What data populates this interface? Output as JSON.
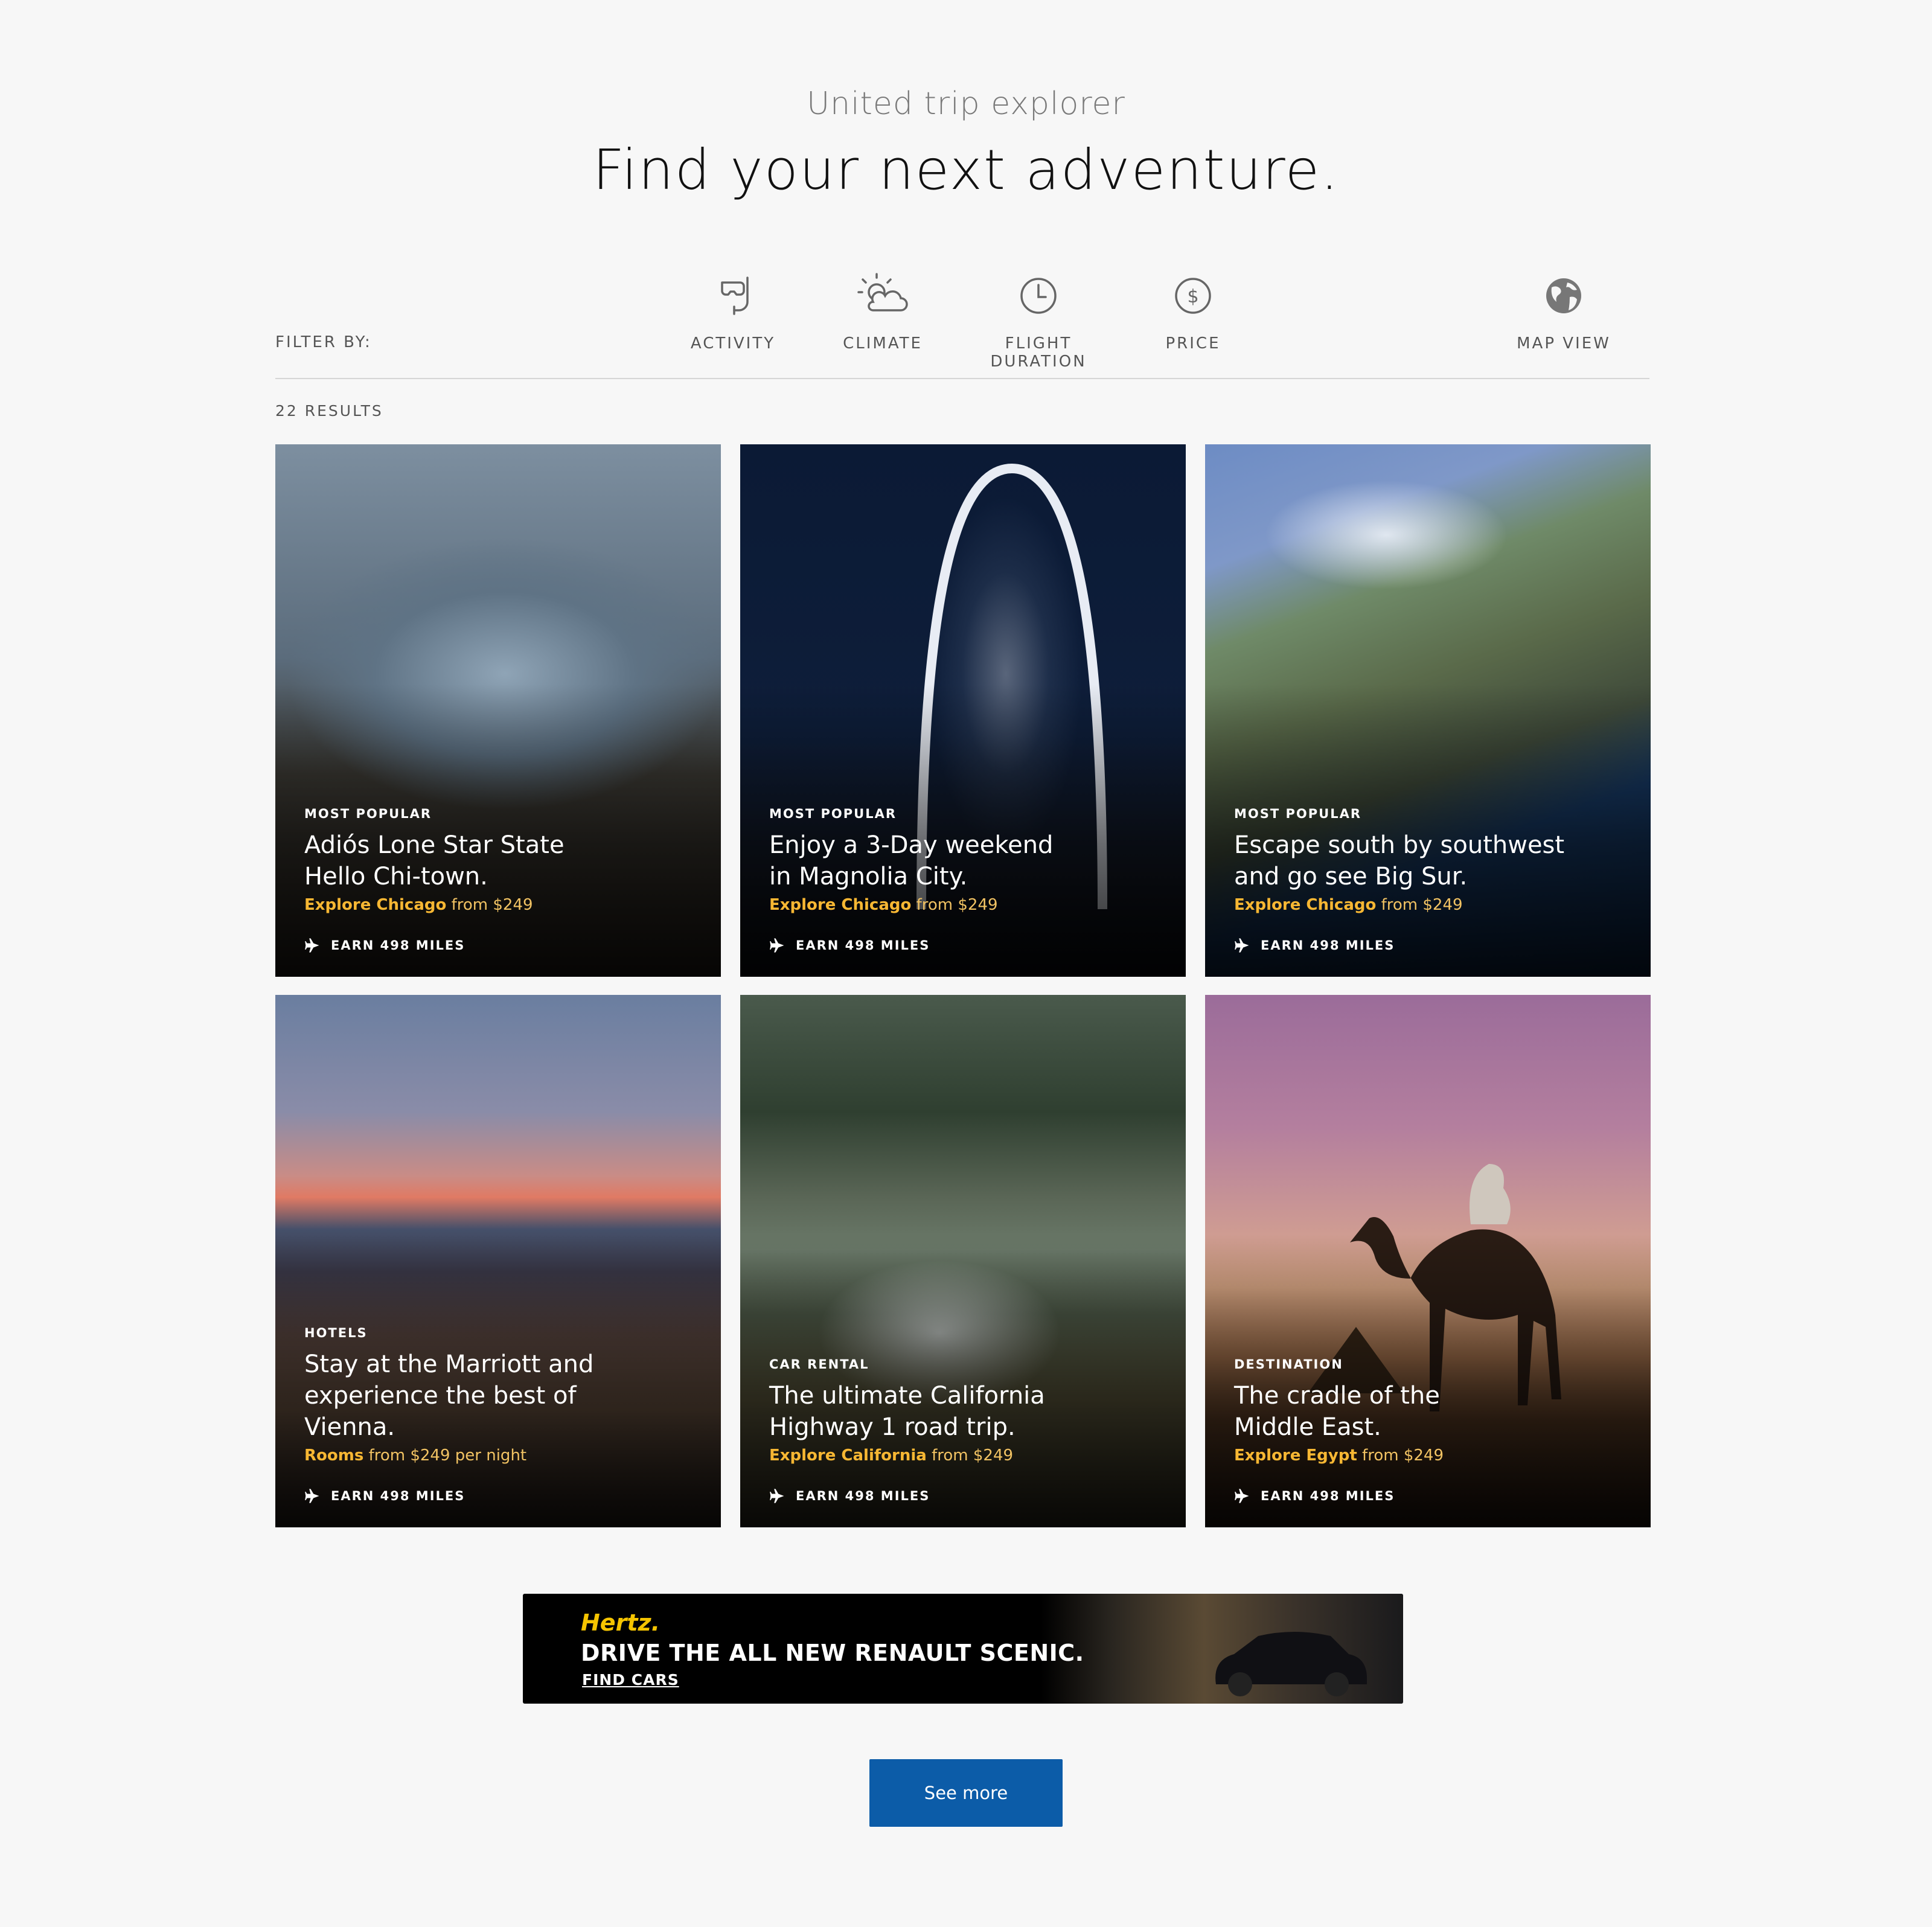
{
  "header": {
    "kicker": "United trip explorer",
    "title": "Find your next adventure."
  },
  "filters": {
    "label": "FILTER BY:",
    "items": [
      {
        "label": "ACTIVITY",
        "icon": "snorkel-icon"
      },
      {
        "label": "CLIMATE",
        "icon": "sun-cloud-icon"
      },
      {
        "label": "FLIGHT DURATION",
        "icon": "clock-icon"
      },
      {
        "label": "PRICE",
        "icon": "dollar-coin-icon"
      }
    ],
    "map_view": {
      "label": "MAP VIEW",
      "icon": "globe-icon"
    }
  },
  "results": {
    "count_text": "22 RESULTS"
  },
  "cards": [
    {
      "tag": "MOST POPULAR",
      "title": "Adiós Lone Star State\nHello Chi-town.",
      "highlight": "Explore Chicago",
      "rest": " from $249",
      "miles": "EARN 498 MILES"
    },
    {
      "tag": "MOST POPULAR",
      "title": "Enjoy a 3-Day weekend\nin Magnolia City.",
      "highlight": "Explore Chicago",
      "rest": " from $249",
      "miles": "EARN 498 MILES"
    },
    {
      "tag": "MOST POPULAR",
      "title": "Escape south by southwest\nand go see Big Sur.",
      "highlight": "Explore Chicago",
      "rest": " from $249",
      "miles": "EARN 498 MILES"
    },
    {
      "tag": "HOTELS",
      "title": "Stay at the Marriott and\nexperience the best of Vienna.",
      "highlight": "Rooms",
      "rest": " from $249 per night",
      "miles": "EARN 498 MILES"
    },
    {
      "tag": "CAR RENTAL",
      "title": "The ultimate California\nHighway 1 road trip.",
      "highlight": "Explore California",
      "rest": " from $249",
      "miles": "EARN 498 MILES"
    },
    {
      "tag": "DESTINATION",
      "title": "The cradle of the\nMiddle East.",
      "highlight": "Explore Egypt",
      "rest": " from $249",
      "miles": "EARN 498 MILES"
    }
  ],
  "ad": {
    "brand": "Hertz.",
    "headline": "DRIVE THE ALL NEW RENAULT SCENIC.",
    "link": "FIND CARS"
  },
  "see_more": {
    "label": "See more"
  },
  "colors": {
    "accent": "#0c5ca8",
    "highlight": "#f7b733",
    "background": "#f7f7f7"
  }
}
